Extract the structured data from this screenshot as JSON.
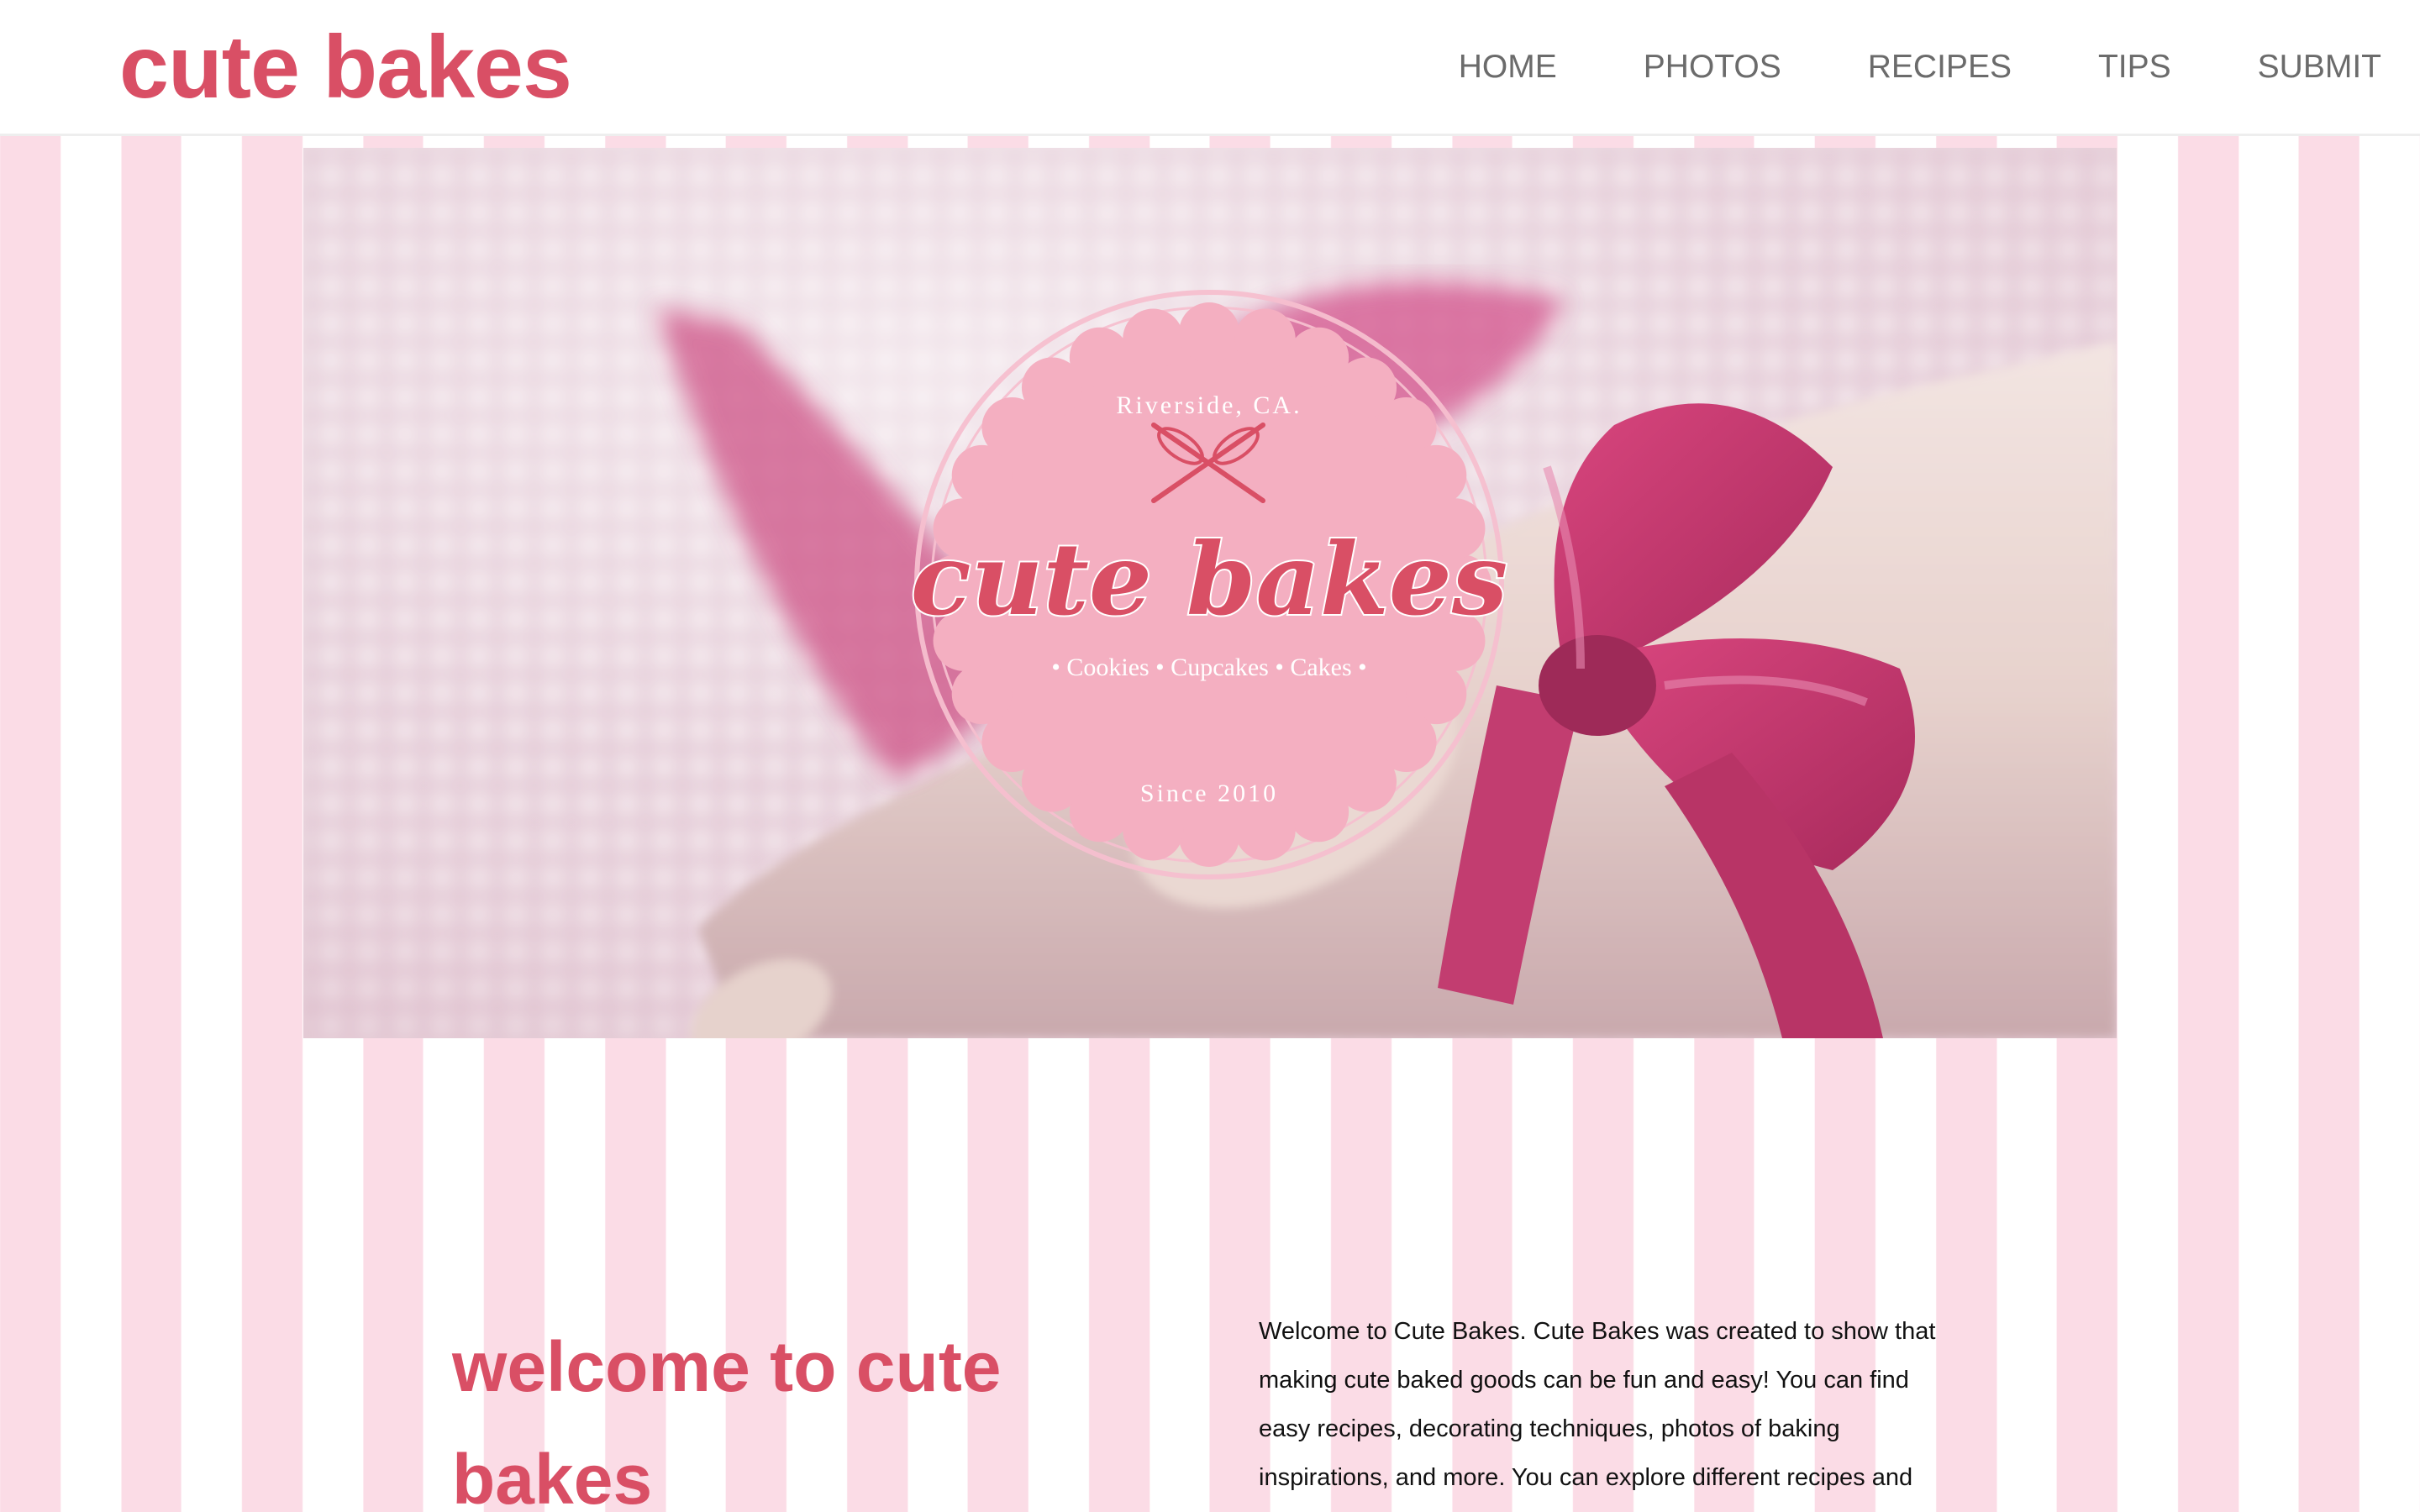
{
  "header": {
    "site_title": "cute bakes",
    "nav": [
      {
        "label": "HOME"
      },
      {
        "label": "PHOTOS"
      },
      {
        "label": "RECIPES"
      },
      {
        "label": "TIPS"
      },
      {
        "label": "SUBMIT"
      }
    ]
  },
  "hero": {
    "logo": {
      "location": "Riverside, CA.",
      "name": "cute bakes",
      "tagline": "• Cookies • Cupcakes • Cakes •",
      "since": "Since 2010"
    }
  },
  "welcome": {
    "heading": "welcome to cute bakes",
    "body": "Welcome to Cute Bakes. Cute Bakes was created to show that making cute baked goods can be fun and easy! You can find easy recipes, decorating techniques, photos of baking inspirations, and more. You can explore different recipes and"
  },
  "colors": {
    "accent": "#d94f65",
    "stripe_pink": "#fbdce6",
    "stripe_white": "#ffffff",
    "nav_text": "#6b6b6b",
    "ribbon": "#c9386e",
    "logo_badge": "#f4afc1"
  },
  "icons": {
    "logo_emblem": "crossed-whisks-icon"
  }
}
